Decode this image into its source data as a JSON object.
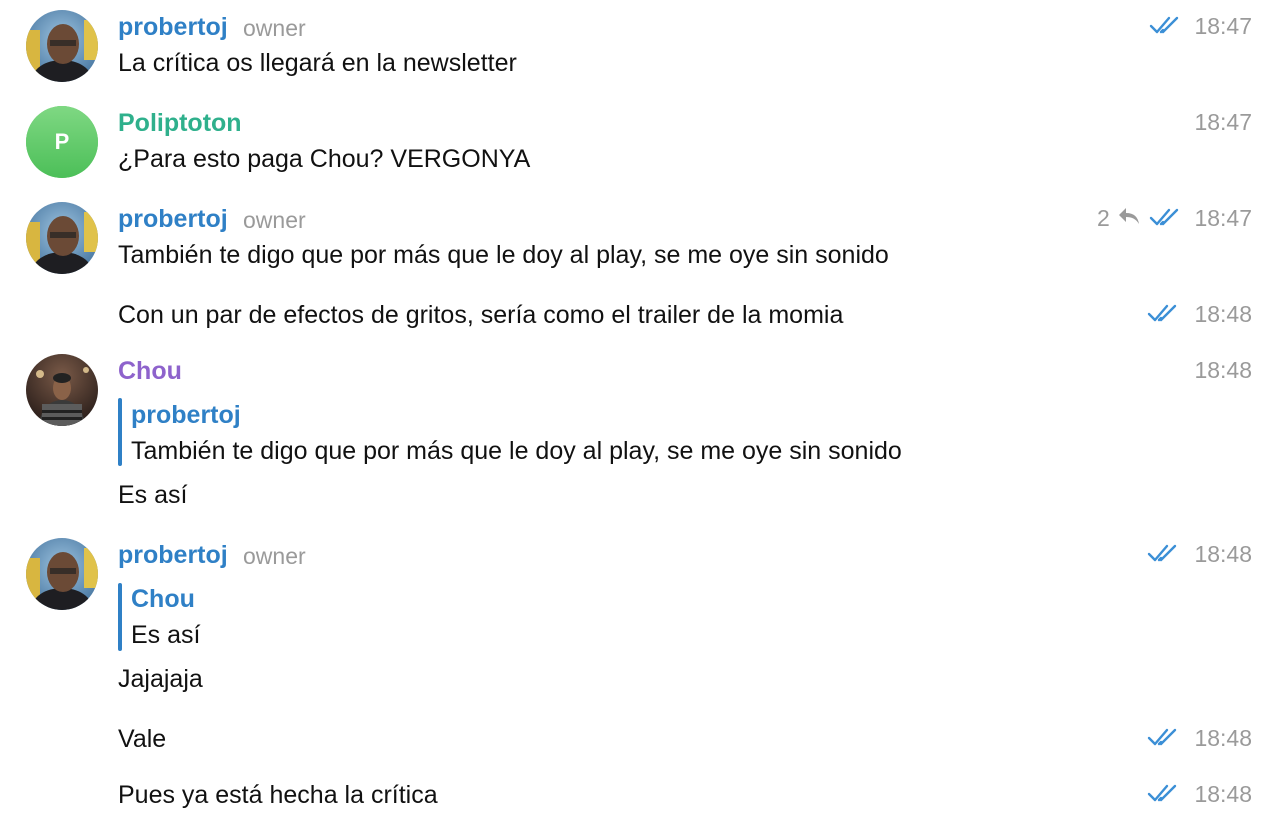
{
  "colors": {
    "owner_name": "#2f80c6",
    "poliptoton_name": "#2fb08c",
    "chou_name": "#8e63cc",
    "quote_bar": "#2f80c6",
    "time": "#9a9a9a",
    "ticks": "#3b8fd6"
  },
  "messages": [
    {
      "sender": "probertoj",
      "role": "owner",
      "text": "La crítica os llegará en la newsletter",
      "time": "18:47",
      "read": "double-check-icon"
    },
    {
      "sender": "Poliptoton",
      "avatar_letter": "P",
      "text": "¿Para esto paga Chou? VERGONYA",
      "time": "18:47"
    },
    {
      "sender": "probertoj",
      "role": "owner",
      "text": "También te digo que por más que le doy al play, se me oye sin sonido",
      "time": "18:47",
      "replies": "2",
      "read": "double-check-icon"
    },
    {
      "text": "Con un par de efectos de gritos, sería como el trailer de la momia",
      "time": "18:48",
      "read": "double-check-icon"
    },
    {
      "sender": "Chou",
      "time": "18:48",
      "quote": {
        "name": "probertoj",
        "text": "También te digo que por más que le doy al play, se me oye sin sonido"
      },
      "text": "Es así"
    },
    {
      "sender": "probertoj",
      "role": "owner",
      "time": "18:48",
      "read": "double-check-icon",
      "quote": {
        "name": "Chou",
        "text": "Es así"
      },
      "text": "Jajajaja"
    },
    {
      "text": "Vale",
      "time": "18:48",
      "read": "double-check-icon"
    },
    {
      "text": "Pues ya está hecha la crítica",
      "time": "18:48",
      "read": "double-check-icon"
    }
  ]
}
